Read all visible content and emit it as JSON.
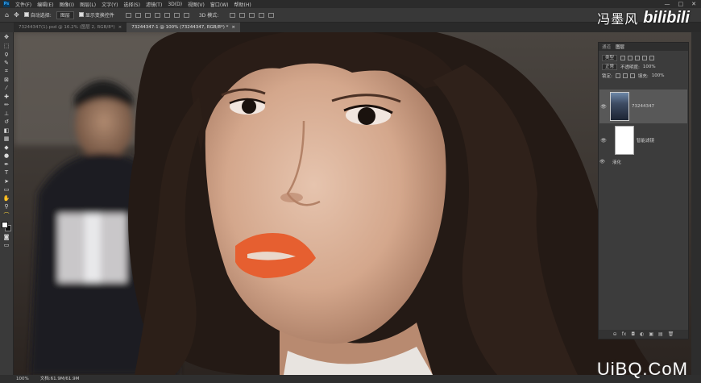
{
  "menu": {
    "logo": "Ps",
    "items": [
      "文件(F)",
      "编辑(E)",
      "图像(I)",
      "图层(L)",
      "文字(Y)",
      "选择(S)",
      "滤镜(T)",
      "3D(D)",
      "视图(V)",
      "窗口(W)",
      "帮助(H)"
    ],
    "window_controls": [
      "—",
      "□",
      "✕"
    ]
  },
  "options": {
    "auto_select_label": "自动选择:",
    "auto_select_value": "图层",
    "show_transform_label": "显示变换控件",
    "mode_3d": "3D 模式:"
  },
  "tabs": [
    {
      "label": "73244347(1).psd @ 16.2% (图层 2, RGB/8*)",
      "close": "×",
      "active": false
    },
    {
      "label": "73244347-1 @ 100% (73244347, RGB/8*) *",
      "close": "×",
      "active": true
    }
  ],
  "toolbar": {
    "tools": [
      {
        "name": "move-tool-icon",
        "glyph": "✥"
      },
      {
        "name": "marquee-tool-icon",
        "glyph": "⬚"
      },
      {
        "name": "lasso-tool-icon",
        "glyph": "ϙ"
      },
      {
        "name": "quick-select-tool-icon",
        "glyph": "✎"
      },
      {
        "name": "crop-tool-icon",
        "glyph": "⌗"
      },
      {
        "name": "frame-tool-icon",
        "glyph": "⊠"
      },
      {
        "name": "eyedropper-tool-icon",
        "glyph": "⁄"
      },
      {
        "name": "healing-brush-tool-icon",
        "glyph": "✚"
      },
      {
        "name": "brush-tool-icon",
        "glyph": "✏"
      },
      {
        "name": "clone-stamp-tool-icon",
        "glyph": "⊥"
      },
      {
        "name": "history-brush-tool-icon",
        "glyph": "↺"
      },
      {
        "name": "eraser-tool-icon",
        "glyph": "◧"
      },
      {
        "name": "gradient-tool-icon",
        "glyph": "▦"
      },
      {
        "name": "blur-tool-icon",
        "glyph": "◆"
      },
      {
        "name": "dodge-tool-icon",
        "glyph": "●"
      },
      {
        "name": "pen-tool-icon",
        "glyph": "✒"
      },
      {
        "name": "type-tool-icon",
        "glyph": "T"
      },
      {
        "name": "path-select-tool-icon",
        "glyph": "➤"
      },
      {
        "name": "rectangle-tool-icon",
        "glyph": "▭"
      },
      {
        "name": "hand-tool-icon",
        "glyph": "✋"
      },
      {
        "name": "zoom-tool-icon",
        "glyph": "⚲"
      },
      {
        "name": "edit-toolbar-icon",
        "glyph": "⌒"
      }
    ]
  },
  "watermark": {
    "channel": "冯墨风",
    "site": "bilibili",
    "bottom": "UiBQ.CoM"
  },
  "layers_panel": {
    "tabs": [
      "通道",
      "图层"
    ],
    "filter_kind": "类型",
    "blend_mode": "正常",
    "opacity_label": "不透明度:",
    "opacity_value": "100%",
    "lock_label": "锁定:",
    "fill_label": "填充:",
    "fill_value": "100%",
    "layers": [
      {
        "name": "73244347",
        "visible": true
      },
      {
        "name": "智能滤镜",
        "visible": true
      }
    ],
    "sub_effect": "液化",
    "bottom_icons": [
      "⊖",
      "fx",
      "◘",
      "◐",
      "▣",
      "▤",
      "🗑"
    ]
  },
  "status": {
    "zoom": "100%",
    "doc": "文档:61.9M/61.9M"
  },
  "colors": {
    "accent": "#30a8ff",
    "panel_bg": "#3c3c3c",
    "ui_dark": "#2b2b2b"
  }
}
